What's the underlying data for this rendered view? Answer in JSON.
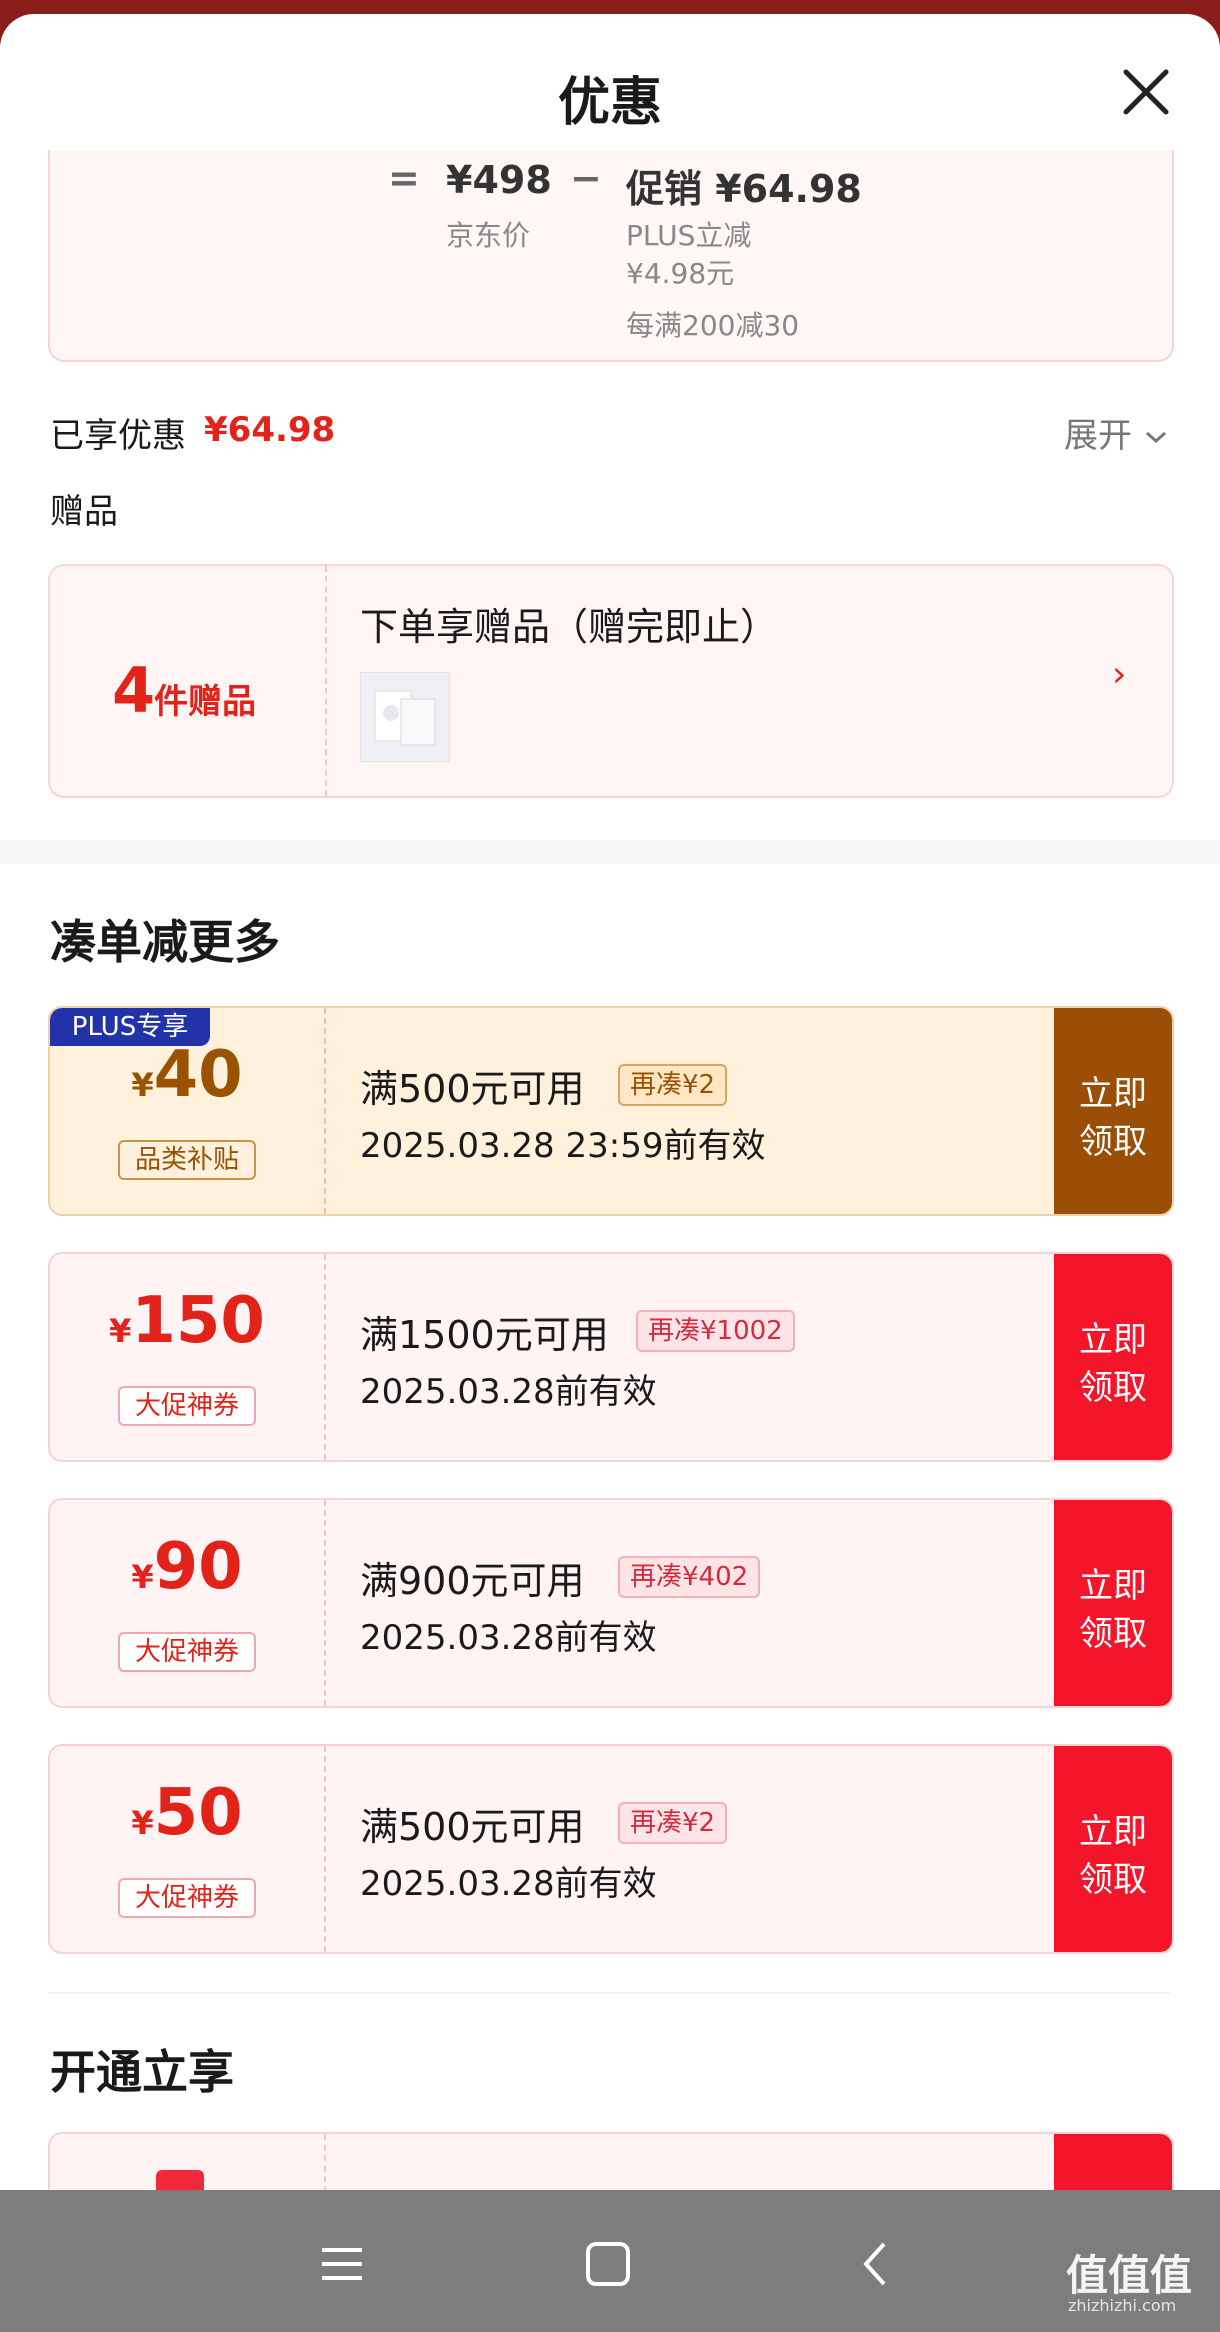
{
  "header": {
    "title": "优惠"
  },
  "price_breakdown": {
    "equals": "=",
    "jd_price": "¥498",
    "jd_price_label": "京东价",
    "minus": "−",
    "promo": "促销 ¥64.98",
    "plus_label": "PLUS立减",
    "plus_value": "¥4.98元",
    "full_reduction": "每满200减30"
  },
  "summary": {
    "label": "已享优惠",
    "amount": "¥64.98",
    "expand": "展开"
  },
  "gifts": {
    "section_label": "赠品",
    "count": "4",
    "count_unit": "件赠品",
    "title": "下单享赠品（赠完即止）"
  },
  "bundle_section": {
    "title": "凑单减更多"
  },
  "coupons": [
    {
      "badge": "PLUS专享",
      "yen": "¥",
      "amount": "40",
      "tag": "品类补贴",
      "condition": "满500元可用",
      "diff": "再凑¥2",
      "expiry": "2025.03.28 23:59前有效",
      "btn1": "立即",
      "btn2": "领取"
    },
    {
      "yen": "¥",
      "amount": "150",
      "tag": "大促神券",
      "condition": "满1500元可用",
      "diff": "再凑¥1002",
      "expiry": "2025.03.28前有效",
      "btn1": "立即",
      "btn2": "领取"
    },
    {
      "yen": "¥",
      "amount": "90",
      "tag": "大促神券",
      "condition": "满900元可用",
      "diff": "再凑¥402",
      "expiry": "2025.03.28前有效",
      "btn1": "立即",
      "btn2": "领取"
    },
    {
      "yen": "¥",
      "amount": "50",
      "tag": "大促神券",
      "condition": "满500元可用",
      "diff": "再凑¥2",
      "expiry": "2025.03.28前有效",
      "btn1": "立即",
      "btn2": "领取"
    }
  ],
  "open_section": {
    "title": "开通立享"
  },
  "watermark": {
    "text": "值值值",
    "domain": "zhizhizhi.com"
  },
  "colors": {
    "accent_red": "#e2231a",
    "button_red": "#f5152a",
    "plus_blue": "#2233a9",
    "gold": "#9a4e06"
  }
}
